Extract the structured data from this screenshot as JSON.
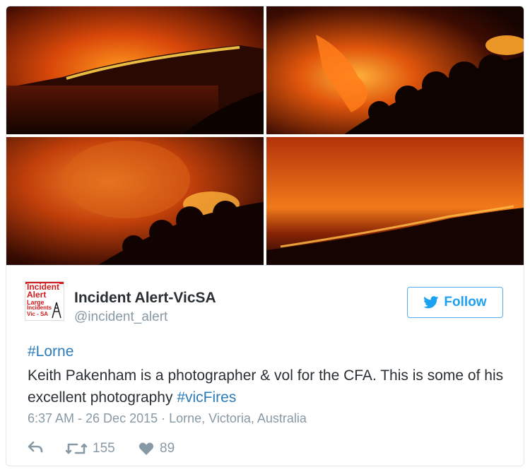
{
  "author": {
    "name": "Incident Alert-VicSA",
    "handle": "@incident_alert",
    "avatar_lines": [
      "Incident",
      "Alert",
      "Large",
      "Incidents",
      "Vic - SA"
    ]
  },
  "follow_label": "Follow",
  "tweet": {
    "hashtag": "#Lorne",
    "text": "Keith Pakenham is a photographer & vol for the CFA. This is some of his excellent photography ",
    "text_hashtag": "#vicFires",
    "timestamp": "6:37 AM - 26 Dec 2015",
    "separator": " · ",
    "location": "Lorne, Victoria, Australia"
  },
  "stats": {
    "retweets": "155",
    "likes": "89"
  },
  "colors": {
    "link": "#2b7bb9",
    "follow": "#1da1f2",
    "muted": "#8899a6",
    "fire": "#ff7a14"
  },
  "icons": {
    "follow": "bird-icon",
    "reply": "reply-icon",
    "retweet": "retweet-icon",
    "like": "heart-icon"
  }
}
